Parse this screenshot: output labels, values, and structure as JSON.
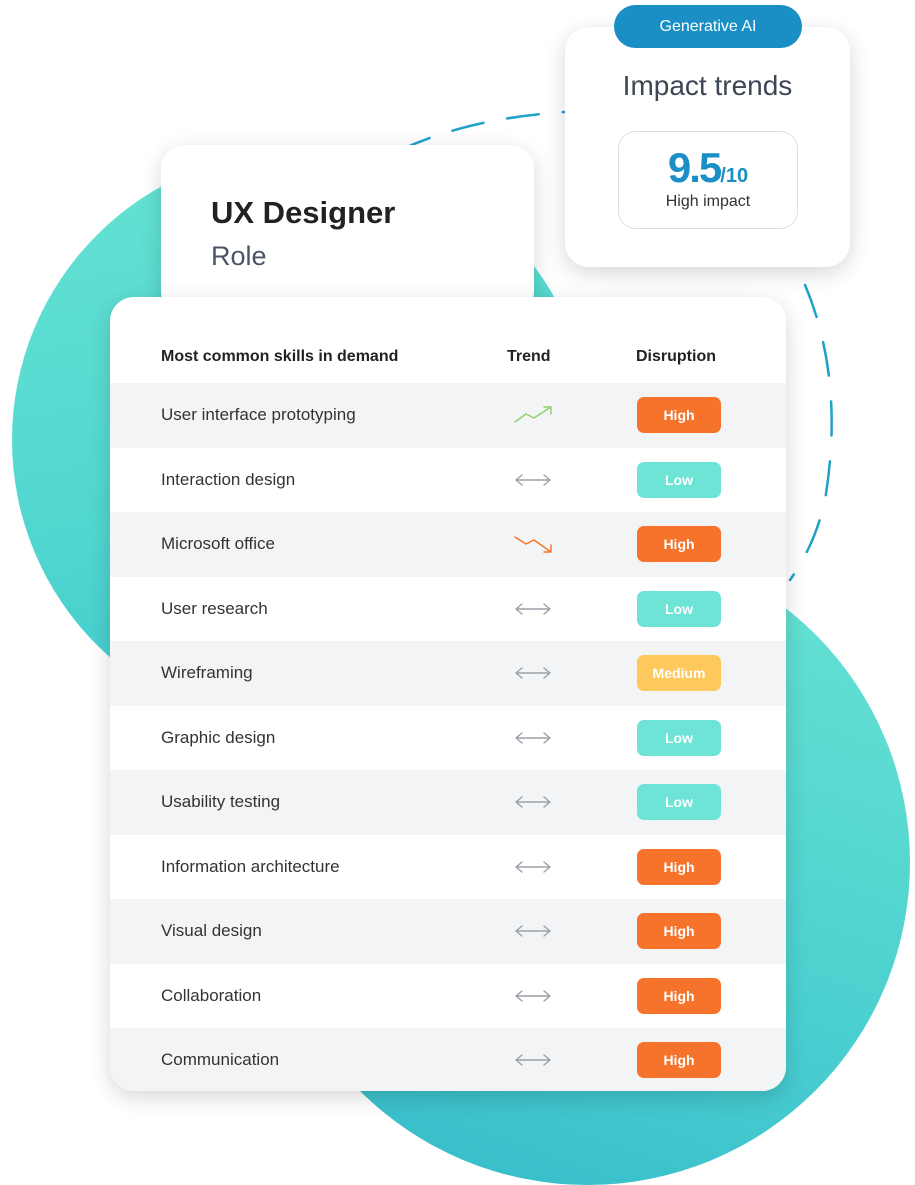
{
  "badge": {
    "label": "Generative AI",
    "color": "#1a8fc6"
  },
  "impact": {
    "title": "Impact trends",
    "score": "9.5",
    "score_max": "/10",
    "label": "High impact"
  },
  "role": {
    "title": "UX Designer",
    "subtitle": "Role"
  },
  "table": {
    "headers": {
      "skill": "Most common skills in demand",
      "trend": "Trend",
      "disruption": "Disruption"
    },
    "rows": [
      {
        "skill": "User interface prototyping",
        "trend": "up",
        "disruption": "High"
      },
      {
        "skill": "Interaction design",
        "trend": "flat",
        "disruption": "Low"
      },
      {
        "skill": "Microsoft office",
        "trend": "down",
        "disruption": "High"
      },
      {
        "skill": "User research",
        "trend": "flat",
        "disruption": "Low"
      },
      {
        "skill": "Wireframing",
        "trend": "flat",
        "disruption": "Medium"
      },
      {
        "skill": "Graphic design",
        "trend": "flat",
        "disruption": "Low"
      },
      {
        "skill": "Usability testing",
        "trend": "flat",
        "disruption": "Low"
      },
      {
        "skill": "Information architecture",
        "trend": "flat",
        "disruption": "High"
      },
      {
        "skill": "Visual design",
        "trend": "flat",
        "disruption": "High"
      },
      {
        "skill": "Collaboration",
        "trend": "flat",
        "disruption": "High"
      },
      {
        "skill": "Communication",
        "trend": "flat",
        "disruption": "High"
      }
    ]
  },
  "colors": {
    "high": "#f5732a",
    "low": "#6ee4d6",
    "medium": "#fdc85c",
    "trend_up": "#8fd06a",
    "trend_down": "#f5732a",
    "trend_flat": "#9aa1a8"
  }
}
